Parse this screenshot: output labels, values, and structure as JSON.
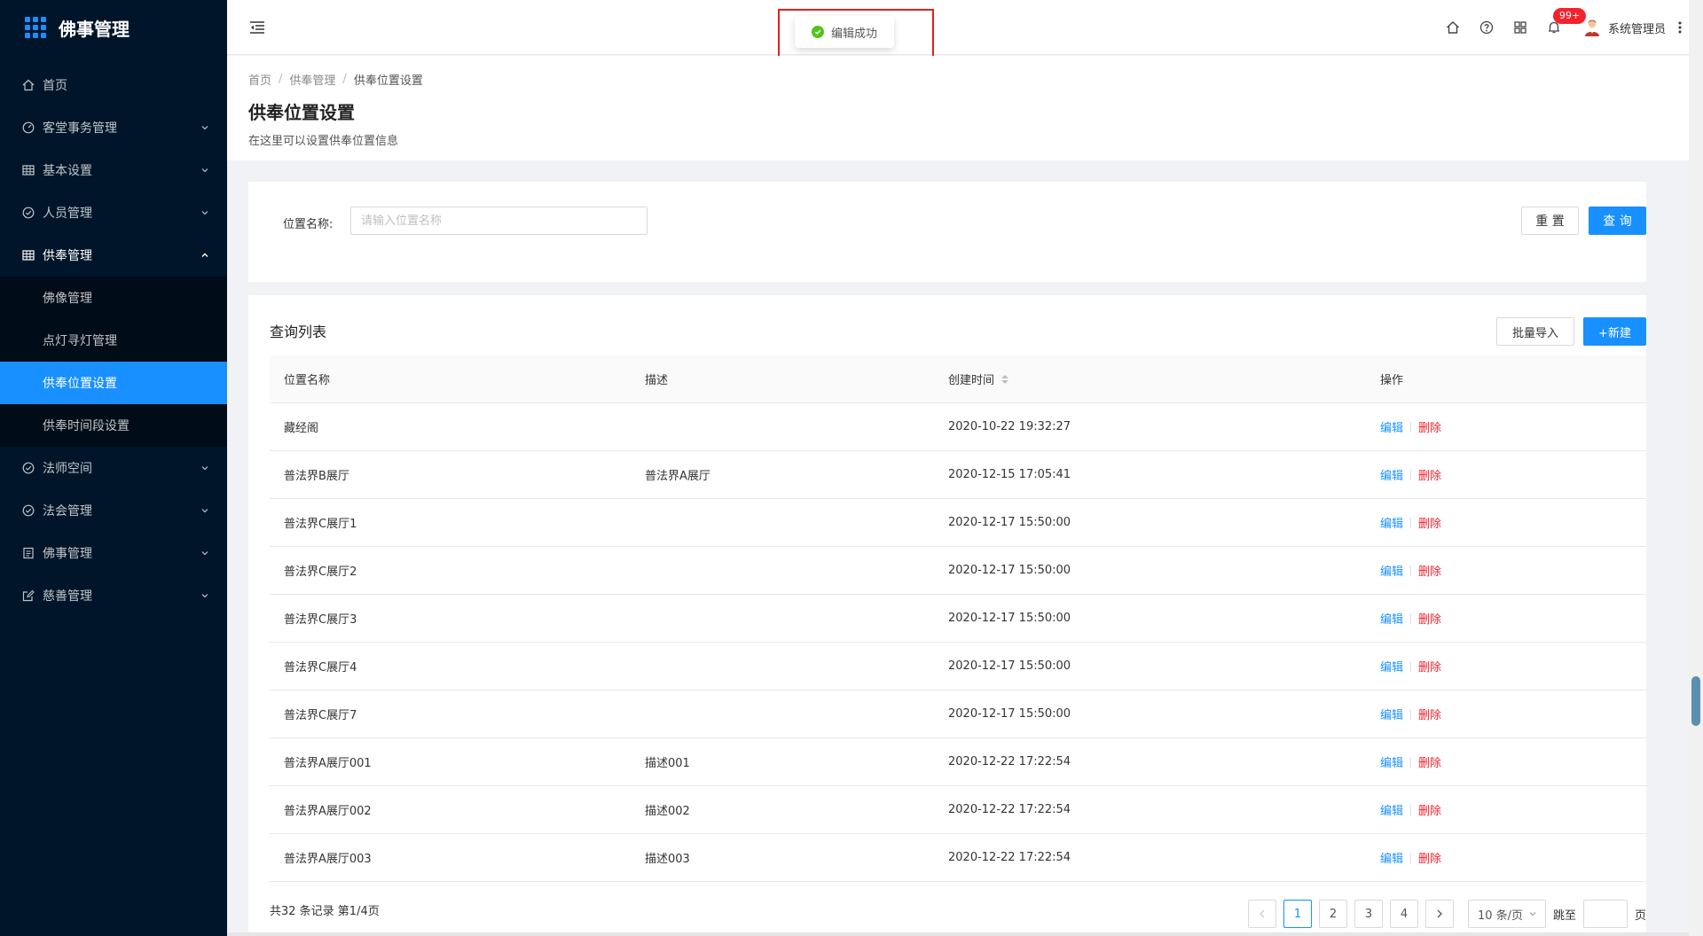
{
  "app": {
    "title": "佛事管理"
  },
  "sidebar": {
    "items": [
      {
        "label": "首页",
        "icon": "home-icon",
        "has_children": false
      },
      {
        "label": "客堂事务管理",
        "icon": "dashboard-icon",
        "has_children": true
      },
      {
        "label": "基本设置",
        "icon": "table-icon",
        "has_children": true
      },
      {
        "label": "人员管理",
        "icon": "check-circle-icon",
        "has_children": true
      },
      {
        "label": "供奉管理",
        "icon": "table-icon",
        "has_children": true,
        "expanded": true,
        "children": [
          {
            "label": "佛像管理"
          },
          {
            "label": "点灯寻灯管理"
          },
          {
            "label": "供奉位置设置",
            "active": true
          },
          {
            "label": "供奉时间段设置"
          }
        ]
      },
      {
        "label": "法师空间",
        "icon": "check-circle-icon",
        "has_children": true
      },
      {
        "label": "法会管理",
        "icon": "check-circle-icon",
        "has_children": true
      },
      {
        "label": "佛事管理",
        "icon": "profile-icon",
        "has_children": true
      },
      {
        "label": "慈善管理",
        "icon": "form-icon",
        "has_children": true
      }
    ]
  },
  "header": {
    "notification_count": "99+",
    "user_name": "系统管理员"
  },
  "toast": {
    "message": "编辑成功"
  },
  "breadcrumb": [
    "首页",
    "供奉管理",
    "供奉位置设置"
  ],
  "page": {
    "title": "供奉位置设置",
    "description": "在这里可以设置供奉位置信息"
  },
  "search": {
    "label": "位置名称:",
    "placeholder": "请输入位置名称",
    "value": "",
    "reset_label": "重 置",
    "query_label": "查 询"
  },
  "list": {
    "title": "查询列表",
    "import_label": "批量导入",
    "new_label": "+新建",
    "columns": [
      "位置名称",
      "描述",
      "创建时间",
      "操作"
    ],
    "edit_label": "编辑",
    "delete_label": "删除",
    "rows": [
      {
        "name": "藏经阁",
        "desc": "",
        "created": "2020-10-22 19:32:27"
      },
      {
        "name": "普法界B展厅",
        "desc": "普法界A展厅",
        "created": "2020-12-15 17:05:41"
      },
      {
        "name": "普法界C展厅1",
        "desc": "",
        "created": "2020-12-17 15:50:00"
      },
      {
        "name": "普法界C展厅2",
        "desc": "",
        "created": "2020-12-17 15:50:00"
      },
      {
        "name": "普法界C展厅3",
        "desc": "",
        "created": "2020-12-17 15:50:00"
      },
      {
        "name": "普法界C展厅4",
        "desc": "",
        "created": "2020-12-17 15:50:00"
      },
      {
        "name": "普法界C展厅7",
        "desc": "",
        "created": "2020-12-17 15:50:00"
      },
      {
        "name": "普法界A展厅001",
        "desc": "描述001",
        "created": "2020-12-22 17:22:54"
      },
      {
        "name": "普法界A展厅002",
        "desc": "描述002",
        "created": "2020-12-22 17:22:54"
      },
      {
        "name": "普法界A展厅003",
        "desc": "描述003",
        "created": "2020-12-22 17:22:54"
      }
    ]
  },
  "pagination": {
    "total_text": "共32 条记录 第1/4页",
    "pages": [
      "1",
      "2",
      "3",
      "4"
    ],
    "current": "1",
    "page_size": "10 条/页",
    "jump_label": "跳至",
    "page_unit": "页"
  },
  "colors": {
    "sidebar_bg": "#001529",
    "primary": "#1890ff",
    "danger": "#f5222d",
    "success": "#52c41a",
    "highlight_frame": "#e02020"
  }
}
